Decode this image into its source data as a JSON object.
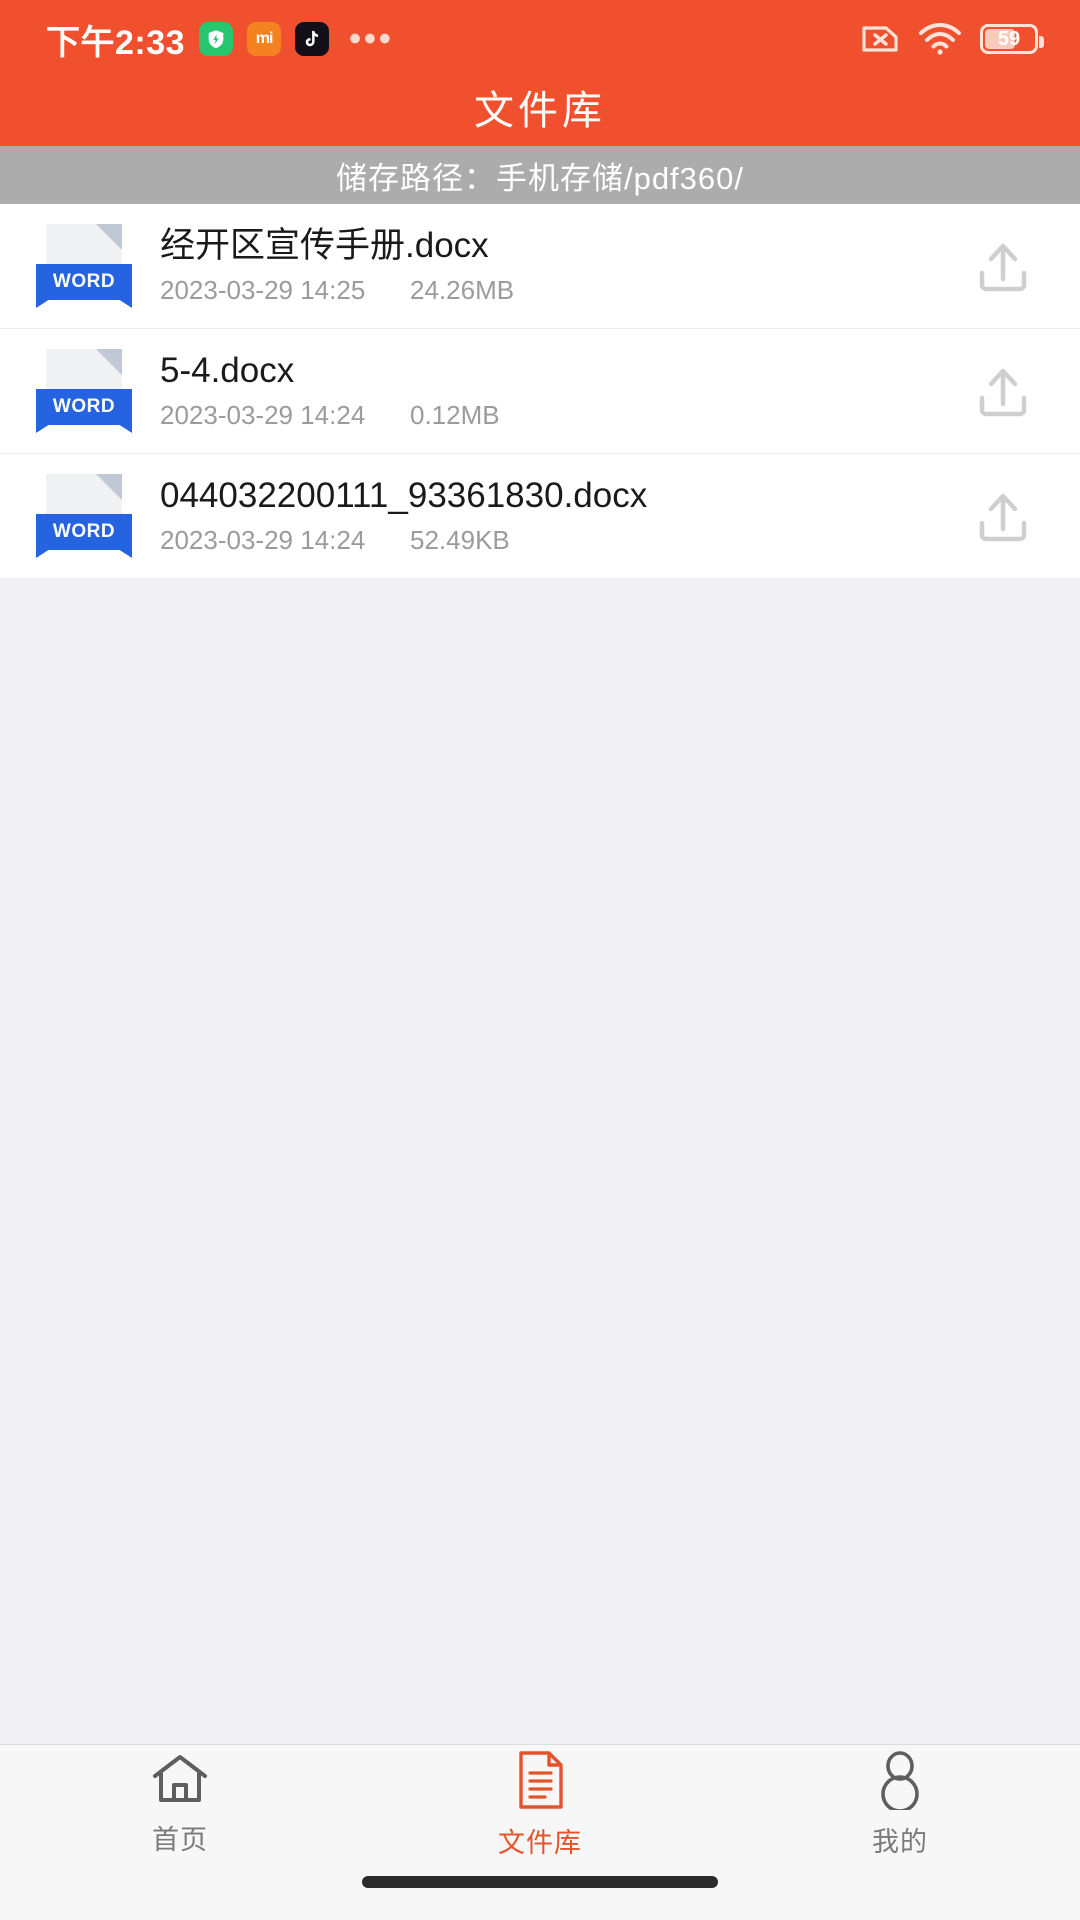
{
  "status_bar": {
    "time": "下午2:33",
    "overflow_dots": "•••",
    "battery_percent": "59",
    "icons": [
      "security-shield-icon",
      "mi-logo-icon",
      "tiktok-icon",
      "no-sim-icon",
      "wifi-icon",
      "battery-icon"
    ],
    "mi_label": "mi"
  },
  "header": {
    "title": "文件库",
    "background_color": "#F0502E"
  },
  "path_bar": {
    "label": "储存路径：",
    "path": "手机存储/pdf360/",
    "full_text": "储存路径：手机存储/pdf360/",
    "background_color": "#ACACAC"
  },
  "file_list": {
    "icon_badge_label": "WORD",
    "upload_action_label": "上传",
    "files": [
      {
        "name": "经开区宣传手册.docx",
        "date": "2023-03-29 14:25",
        "size": "24.26MB",
        "type": "WORD"
      },
      {
        "name": "5-4.docx",
        "date": "2023-03-29 14:24",
        "size": "0.12MB",
        "type": "WORD"
      },
      {
        "name": "044032200111_93361830.docx",
        "date": "2023-03-29 14:24",
        "size": "52.49KB",
        "type": "WORD"
      }
    ]
  },
  "bottom_nav": {
    "active_color": "#E4542C",
    "inactive_color": "#7A7A7A",
    "items": [
      {
        "label": "首页",
        "icon": "home-icon",
        "active": false
      },
      {
        "label": "文件库",
        "icon": "document-icon",
        "active": true
      },
      {
        "label": "我的",
        "icon": "person-icon",
        "active": false
      }
    ]
  }
}
